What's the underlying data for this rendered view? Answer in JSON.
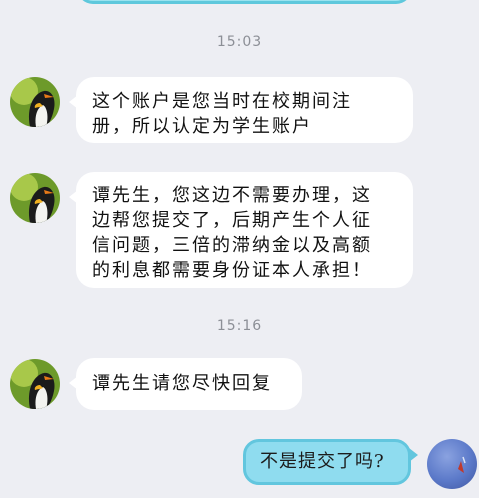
{
  "chat": {
    "messages": [
      {
        "type": "time",
        "text": "15:03"
      },
      {
        "type": "incoming",
        "sender_avatar": "penguin-avatar",
        "lines": [
          "这个账户是您当时在校期间注",
          "册，所以认定为学生账户"
        ]
      },
      {
        "type": "incoming",
        "sender_avatar": "penguin-avatar",
        "lines": [
          "谭先生，您这边不需要办理，这",
          "边帮您提交了，后期产生个人征",
          "信问题，三倍的滞纳金以及高额",
          "的利息都需要身份证本人承担！"
        ]
      },
      {
        "type": "time",
        "text": "15:16"
      },
      {
        "type": "incoming",
        "sender_avatar": "penguin-avatar",
        "lines": [
          "谭先生请您尽快回复"
        ]
      },
      {
        "type": "outgoing",
        "text": "不是提交了吗?",
        "sender_avatar": "self-avatar"
      }
    ]
  },
  "colors": {
    "background": "#edeef3",
    "incoming_bubble": "#ffffff",
    "outgoing_bubble": "#8fdcef",
    "outgoing_border": "#62c6de"
  }
}
